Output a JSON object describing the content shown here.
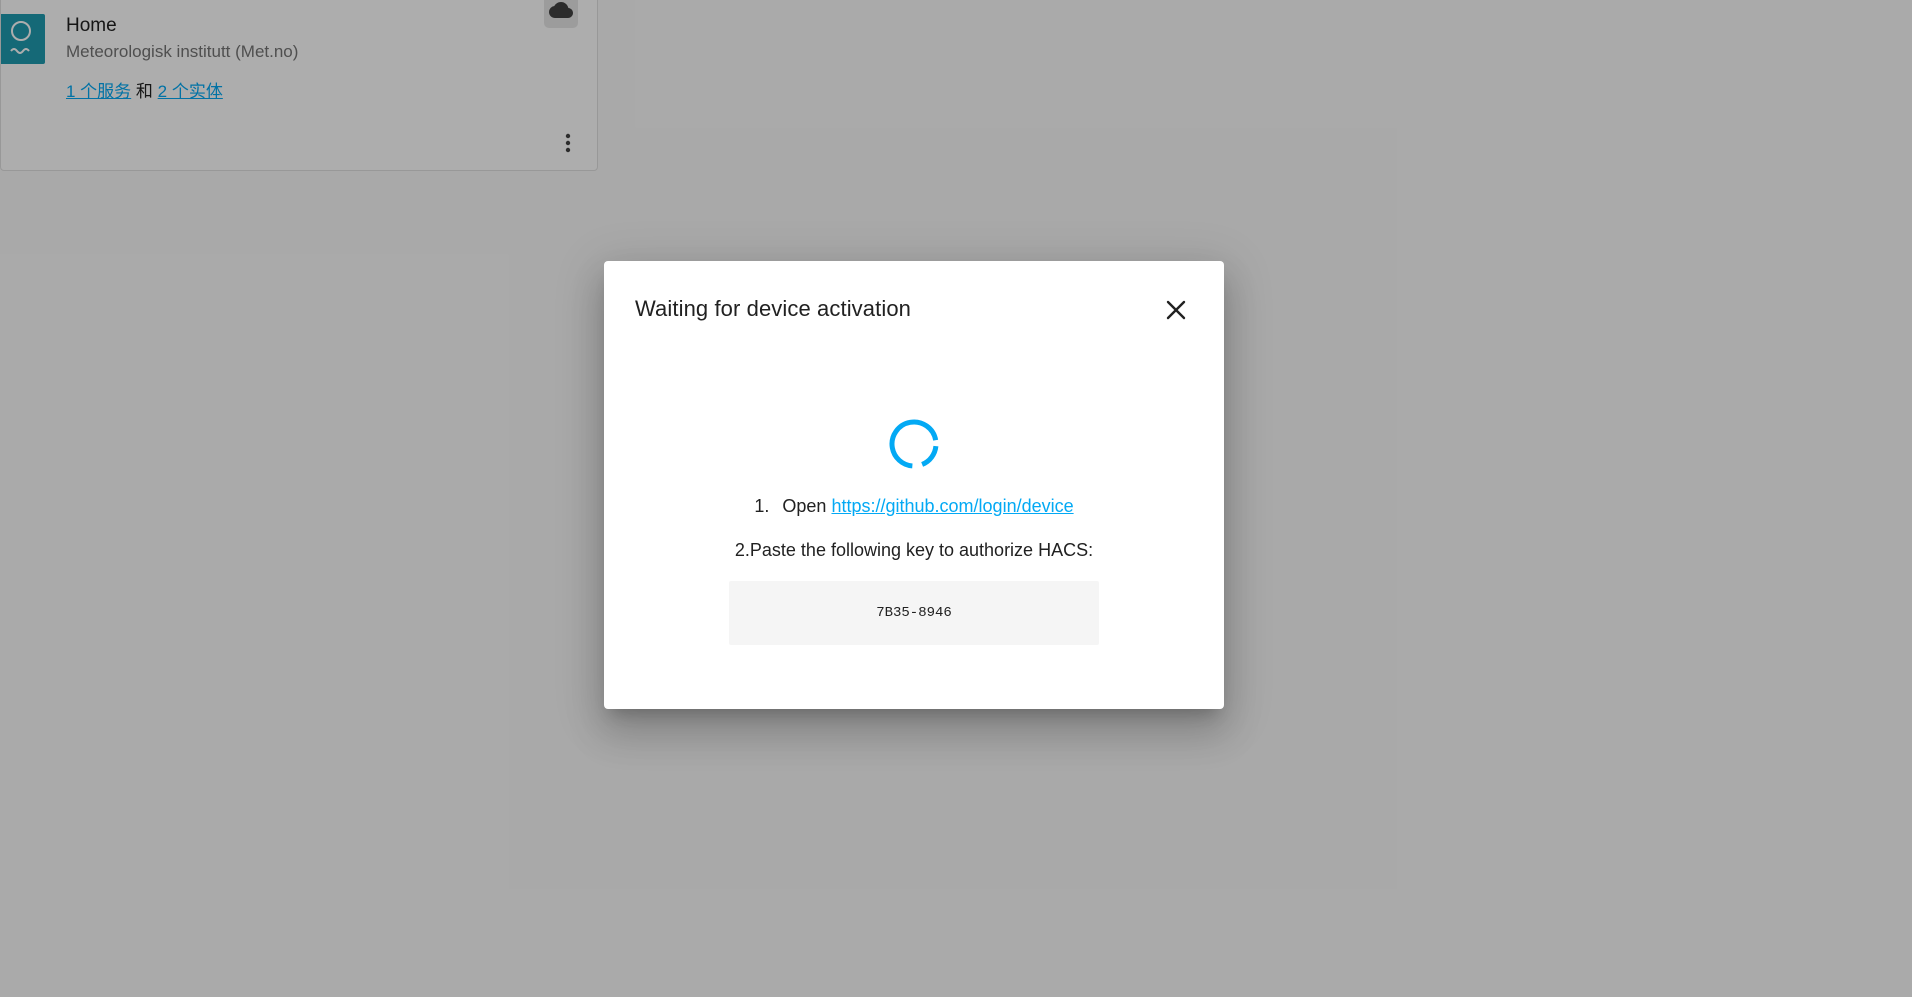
{
  "integration_card": {
    "title": "Home",
    "subtitle": "Meteorologisk institutt (Met.no)",
    "services_link": "1 个服务",
    "joiner": "和",
    "entities_link": "2 个实体",
    "brand_icon": "met-no-logo",
    "badge_icon": "cloud-icon",
    "menu_icon": "dots-vertical-icon"
  },
  "dialog": {
    "title": "Waiting for device activation",
    "close_icon": "close-icon",
    "step1_number": "1.",
    "step1_prefix": "Open",
    "step1_link": "https://github.com/login/device",
    "step2_text": "2.Paste the following key to authorize HACS:",
    "device_code": "7B35-8946"
  },
  "colors": {
    "link": "#03a9f4",
    "brand_teal": "#1f9bb0",
    "scrim": "rgba(0,0,0,0.32)"
  }
}
